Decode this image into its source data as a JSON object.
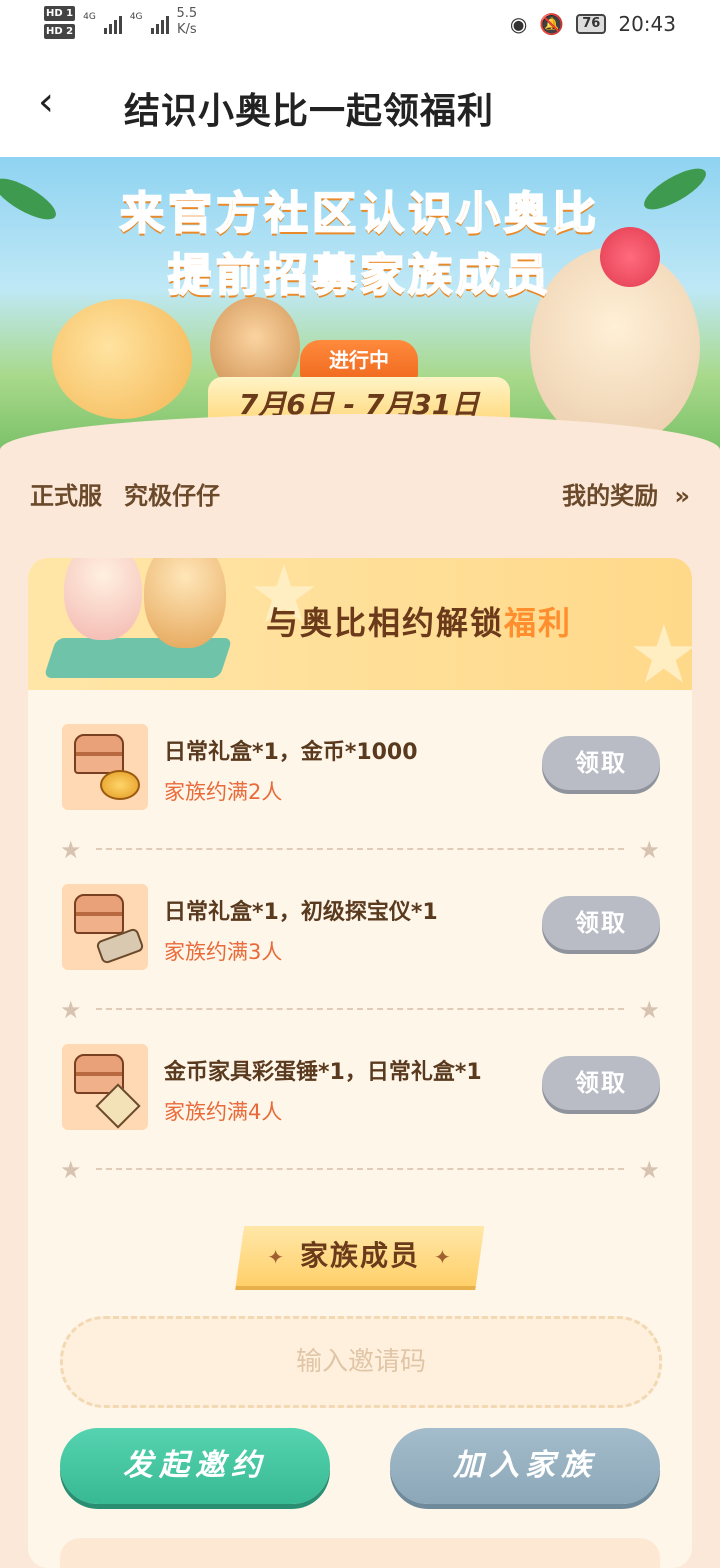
{
  "status_bar": {
    "hd1": "HD 1",
    "hd2": "HD 2",
    "net1": "4G",
    "net2": "4G",
    "speed_value": "5.5",
    "speed_unit": "K/s",
    "battery": "76",
    "time": "20:43"
  },
  "header": {
    "back_icon": "chevron-left",
    "title": "结识小奥比一起领福利"
  },
  "banner": {
    "line1": "来官方社区认识小奥比",
    "line2": "提前招募家族成员",
    "status": "进行中",
    "date_range": "7月6日 - 7月31日"
  },
  "server_row": {
    "server": "正式服",
    "player": "究极仔仔",
    "my_rewards": "我的奖励",
    "arrow": "»"
  },
  "card": {
    "title_main": "与奥比相约解锁",
    "title_highlight": "福利",
    "rewards": [
      {
        "name": "日常礼盒*1，金币*1000",
        "condition": "家族约满2人",
        "button": "领取",
        "icon": "chest-coin-icon"
      },
      {
        "name": "日常礼盒*1，初级探宝仪*1",
        "condition": "家族约满3人",
        "button": "领取",
        "icon": "chest-detector-icon"
      },
      {
        "name": "金币家具彩蛋锤*1，日常礼盒*1",
        "condition": "家族约满4人",
        "button": "领取",
        "icon": "chest-hammer-icon"
      }
    ],
    "members_title": "家族成员",
    "invite_placeholder": "输入邀请码",
    "start_invite": "发起邀约",
    "join_family": "加入家族"
  },
  "colors": {
    "page_bg": "#fbe8d8",
    "accent_orange": "#ff8f2e",
    "condition_text": "#e86a3a",
    "claim_disabled": "#b9bcc4",
    "start_button": "#37b993",
    "join_button": "#8ba7b8"
  }
}
